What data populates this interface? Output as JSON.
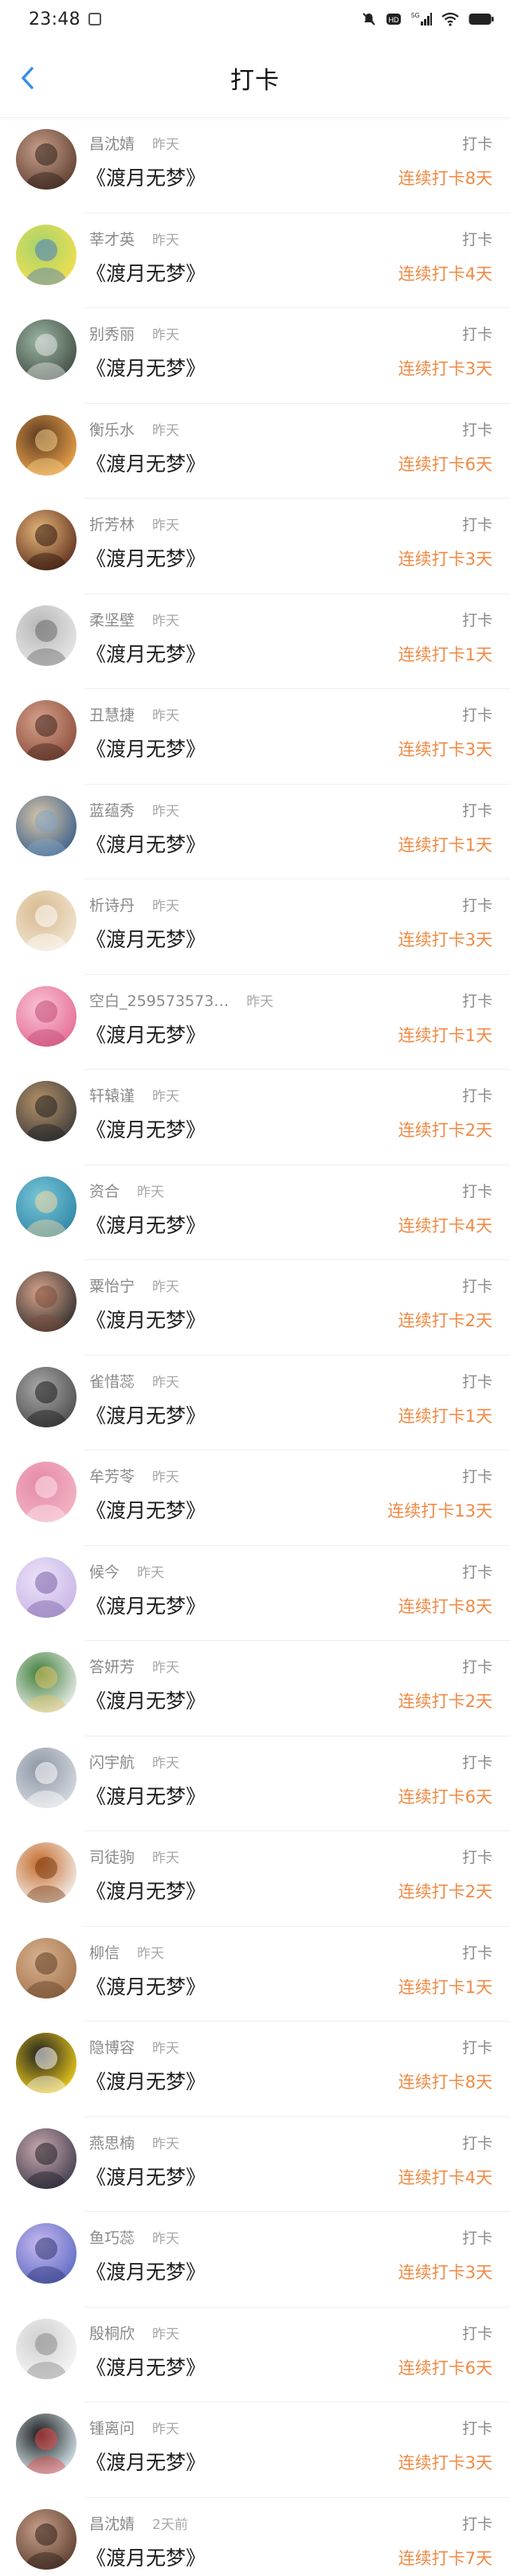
{
  "status": {
    "time": "23:48",
    "network": "5G"
  },
  "header": {
    "title": "打卡"
  },
  "colors": {
    "streak": "#f08a44",
    "back": "#3a8ee6"
  },
  "rows": [
    {
      "name": "昌沈婧",
      "when": "昨天",
      "book": "《渡月无梦》",
      "action": "打卡",
      "streak": "连续打卡8天"
    },
    {
      "name": "莘才英",
      "when": "昨天",
      "book": "《渡月无梦》",
      "action": "打卡",
      "streak": "连续打卡4天"
    },
    {
      "name": "别秀丽",
      "when": "昨天",
      "book": "《渡月无梦》",
      "action": "打卡",
      "streak": "连续打卡3天"
    },
    {
      "name": "衡乐水",
      "when": "昨天",
      "book": "《渡月无梦》",
      "action": "打卡",
      "streak": "连续打卡6天"
    },
    {
      "name": "折芳林",
      "when": "昨天",
      "book": "《渡月无梦》",
      "action": "打卡",
      "streak": "连续打卡3天"
    },
    {
      "name": "柔坚壁",
      "when": "昨天",
      "book": "《渡月无梦》",
      "action": "打卡",
      "streak": "连续打卡1天"
    },
    {
      "name": "丑慧捷",
      "when": "昨天",
      "book": "《渡月无梦》",
      "action": "打卡",
      "streak": "连续打卡3天"
    },
    {
      "name": "蓝蕴秀",
      "when": "昨天",
      "book": "《渡月无梦》",
      "action": "打卡",
      "streak": "连续打卡1天"
    },
    {
      "name": "析诗丹",
      "when": "昨天",
      "book": "《渡月无梦》",
      "action": "打卡",
      "streak": "连续打卡3天"
    },
    {
      "name": "空白_259573573…",
      "when": "昨天",
      "book": "《渡月无梦》",
      "action": "打卡",
      "streak": "连续打卡1天"
    },
    {
      "name": "轩辕谨",
      "when": "昨天",
      "book": "《渡月无梦》",
      "action": "打卡",
      "streak": "连续打卡2天"
    },
    {
      "name": "资合",
      "when": "昨天",
      "book": "《渡月无梦》",
      "action": "打卡",
      "streak": "连续打卡4天"
    },
    {
      "name": "粟怡宁",
      "when": "昨天",
      "book": "《渡月无梦》",
      "action": "打卡",
      "streak": "连续打卡2天"
    },
    {
      "name": "雀惜蕊",
      "when": "昨天",
      "book": "《渡月无梦》",
      "action": "打卡",
      "streak": "连续打卡1天"
    },
    {
      "name": "牟芳苓",
      "when": "昨天",
      "book": "《渡月无梦》",
      "action": "打卡",
      "streak": "连续打卡13天"
    },
    {
      "name": "候今",
      "when": "昨天",
      "book": "《渡月无梦》",
      "action": "打卡",
      "streak": "连续打卡8天"
    },
    {
      "name": "答妍芳",
      "when": "昨天",
      "book": "《渡月无梦》",
      "action": "打卡",
      "streak": "连续打卡2天"
    },
    {
      "name": "闪宇航",
      "when": "昨天",
      "book": "《渡月无梦》",
      "action": "打卡",
      "streak": "连续打卡6天"
    },
    {
      "name": "司徒驹",
      "when": "昨天",
      "book": "《渡月无梦》",
      "action": "打卡",
      "streak": "连续打卡2天"
    },
    {
      "name": "柳信",
      "when": "昨天",
      "book": "《渡月无梦》",
      "action": "打卡",
      "streak": "连续打卡1天"
    },
    {
      "name": "隐博容",
      "when": "昨天",
      "book": "《渡月无梦》",
      "action": "打卡",
      "streak": "连续打卡8天"
    },
    {
      "name": "燕思楠",
      "when": "昨天",
      "book": "《渡月无梦》",
      "action": "打卡",
      "streak": "连续打卡4天"
    },
    {
      "name": "鱼巧蕊",
      "when": "昨天",
      "book": "《渡月无梦》",
      "action": "打卡",
      "streak": "连续打卡3天"
    },
    {
      "name": "殷桐欣",
      "when": "昨天",
      "book": "《渡月无梦》",
      "action": "打卡",
      "streak": "连续打卡6天"
    },
    {
      "name": "锺离问",
      "when": "昨天",
      "book": "《渡月无梦》",
      "action": "打卡",
      "streak": "连续打卡3天"
    },
    {
      "name": "昌沈婧",
      "when": "2天前",
      "book": "《渡月无梦》",
      "action": "打卡",
      "streak": "连续打卡7天"
    }
  ]
}
